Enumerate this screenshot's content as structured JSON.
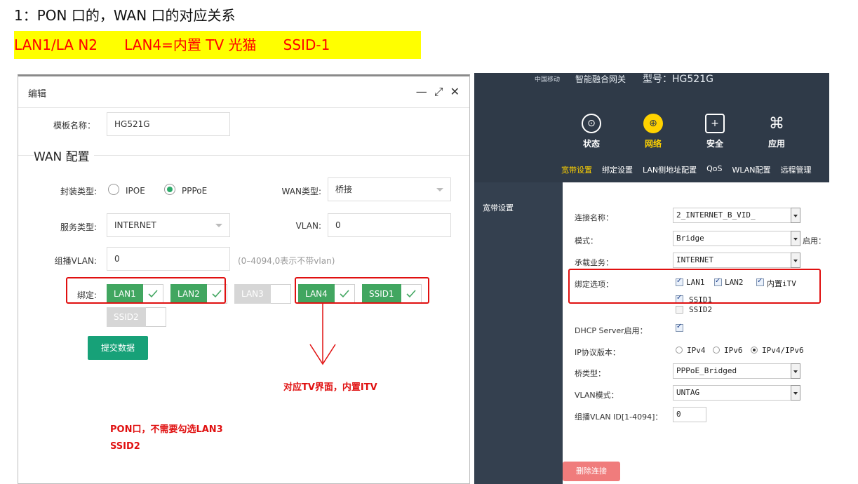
{
  "heading": "1：PON 口的，WAN 口的对应关系",
  "highlight": "LAN1/LA N2      LAN4=内置 TV 光猫      SSID-1",
  "dialog": {
    "title": "编辑",
    "controls": [
      "—",
      "⤢",
      "✕"
    ],
    "template_label": "模板名称：",
    "template_value": "HG521G",
    "section": "WAN 配置",
    "encap_label": "封装类型:",
    "encap_options": [
      "IPOE",
      "PPPoE"
    ],
    "encap_selected": "PPPoE",
    "wan_type_label": "WAN类型:",
    "wan_type_value": "桥接",
    "service_label": "服务类型:",
    "service_value": "INTERNET",
    "vlan_label": "VLAN:",
    "vlan_value": "0",
    "mcast_label": "组播VLAN:",
    "mcast_value": "0",
    "mcast_hint": "(0–4094,0表示不带vlan)",
    "bind_label": "绑定:",
    "binds": [
      {
        "name": "LAN1",
        "checked": true
      },
      {
        "name": "LAN2",
        "checked": true
      },
      {
        "name": "LAN3",
        "checked": false
      },
      {
        "name": "LAN4",
        "checked": true
      },
      {
        "name": "SSID1",
        "checked": true
      },
      {
        "name": "SSID2",
        "checked": false
      }
    ],
    "submit": "提交数据"
  },
  "annotations": {
    "tv_note": "对应TV界面，内置ITV",
    "pon_note_1": "PON口，不需要勾选LAN3",
    "pon_note_2": "SSID2"
  },
  "router": {
    "brand": "中国移动",
    "title": "智能融合网关",
    "model": "型号：HG521G",
    "nav": [
      "状态",
      "网络",
      "安全",
      "应用"
    ],
    "nav_active": "网络",
    "subnav": [
      "宽带设置",
      "绑定设置",
      "LAN侧地址配置",
      "QoS",
      "WLAN配置",
      "远程管理"
    ],
    "subnav_active": "宽带设置",
    "side": "宽带设置",
    "conn_label": "连接名称：",
    "conn_value": "2_INTERNET_B_VID_",
    "mode_label": "模式：",
    "mode_value": "Bridge",
    "mode_extra": "启用：",
    "service_label": "承载业务：",
    "service_value": "INTERNET",
    "bind_label": "绑定选项：",
    "bind_opts": [
      "LAN1",
      "LAN2",
      "内置iTV",
      "SSID1",
      "SSID2"
    ],
    "dhcp_label": "DHCP Server启用：",
    "ip_label": "IP协议版本：",
    "ip_opts": [
      "IPv4",
      "IPv6",
      "IPv4/IPv6"
    ],
    "bridge_label": "桥类型：",
    "bridge_value": "PPPoE_Bridged",
    "vlan_mode_label": "VLAN模式：",
    "vlan_mode_value": "UNTAG",
    "mcast_label": "组播VLAN ID[1-4094]：",
    "mcast_value": "0",
    "delete": "删除连接"
  },
  "colors": {
    "accent_green": "#41a660",
    "submit_green": "#17a178",
    "annotation_red": "#e01010",
    "router_bg": "#2f3a48",
    "router_active": "#ffd200"
  }
}
